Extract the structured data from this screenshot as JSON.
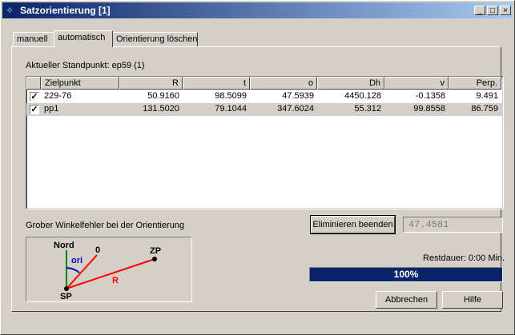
{
  "window": {
    "title": "Satzorientierung [1]"
  },
  "titlebar_buttons": {
    "minimize": "_",
    "maximize": "□",
    "close": "×"
  },
  "tabs": [
    {
      "label": "manuell"
    },
    {
      "label": "automatisch"
    },
    {
      "label": "Orientierung löschen"
    }
  ],
  "standpoint_label": "Aktueller Standpunkt: ep59 (1)",
  "table": {
    "columns": [
      "Zielpunkt",
      "R",
      "t",
      "o",
      "Dh",
      "v",
      "Perp."
    ],
    "rows": [
      {
        "checked": "✓",
        "values": [
          "229-76",
          "50.9160",
          "98.5099",
          "47.5939",
          "4450.128",
          "-0.1358",
          "9.491"
        ]
      },
      {
        "checked": "✓",
        "values": [
          "pp1",
          "131.5020",
          "79.1044",
          "347.6024",
          "55.312",
          "99.8558",
          "86.759"
        ]
      }
    ]
  },
  "error_label": "Grober Winkelfehler bei der Orientierung",
  "eliminate_button": "Eliminieren beenden",
  "eliminate_value": "47.4581",
  "diagram": {
    "nord": "Nord",
    "zero": "0",
    "ori": "ori",
    "zp": "ZP",
    "r": "R",
    "sp": "SP"
  },
  "remaining_label": "Restdauer: 0:00 Min.",
  "progress": {
    "percent": 100,
    "label": "100%"
  },
  "buttons": {
    "cancel": "Abbrechen",
    "help": "Hilfe"
  },
  "colors": {
    "titlebar": "#0a246a",
    "progress": "#0a246a",
    "line_red": "#ff0000",
    "line_green": "#008000",
    "arc_blue": "#0000c0"
  }
}
